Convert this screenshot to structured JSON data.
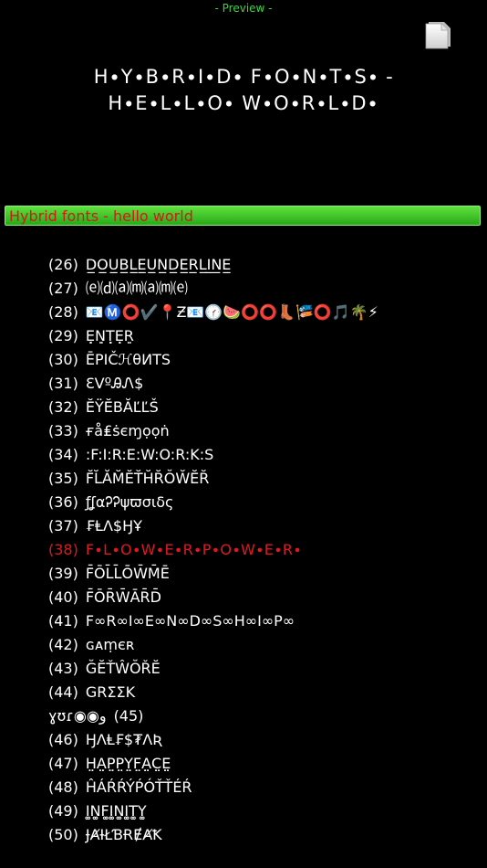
{
  "header": {
    "preview_label": "- Preview -",
    "copy_icon": "copy-document-icon"
  },
  "preview": {
    "line1": "H∙Y∙B∙R∙I∙D∙ F∙O∙N∙T∙S∙ -",
    "line2": "H∙E∙L∙L∙O∙ W∙O∙R∙L∙D∙"
  },
  "selected": {
    "label": "Hybrid fonts - hello world"
  },
  "colors": {
    "selected_bar": "#3cc42a",
    "active_text": "#e0191e",
    "preview_label": "#3fd43f"
  },
  "fonts": [
    {
      "num": "(26)",
      "sample": "D̲O̲U̲B̲L̲E̲U̲N̲D̲E̲R̲L̲I̲N̲E̲"
    },
    {
      "num": "(27)",
      "sample": "⒠⒟⒜⒨⒜⒨⒠"
    },
    {
      "num": "(28)",
      "sample": "📧Ⓜ️⭕✔️📍Ƶ📧🕜🍉⭕⭕👢🎏⭕🎵🌴⚡"
    },
    {
      "num": "(29)",
      "sample": "Ẹ̣Ṇ̣Ṭ̣Ẹ̣Ṛ̣"
    },
    {
      "num": "(30)",
      "sample": "ĒΡΙČℋθИTS"
    },
    {
      "num": "(31)",
      "sample": "ƐVºᎯᏁ$"
    },
    {
      "num": "(32)",
      "sample": "ĔŸĔBĂĽĽŠ"
    },
    {
      "num": "(33)",
      "sample": "ғå₤ṡєɱọọṅ"
    },
    {
      "num": "(34)",
      "sample": ":F:I:R:E:W:O:R:K:S"
    },
    {
      "num": "(35)",
      "sample": "F̆L̆ĂM̆ĔT̆H̆R̆ŎW̆ĔR̆"
    },
    {
      "num": "(36)",
      "sample": "ƒʆαᎮᎮψϖσιδς"
    },
    {
      "num": "(37)",
      "sample": "₣ⱠΛ$ӇҰ"
    },
    {
      "num": "(38)",
      "sample": "F∙L∙O∙W∙E∙R∙P∙O∙W∙E∙R∙",
      "active": true
    },
    {
      "num": "(39)",
      "sample": "F̄ŌL̄L̄ŌW̄M̄Ē"
    },
    {
      "num": "(40)",
      "sample": "F̄ŌR̄W̄ĀR̄D̄"
    },
    {
      "num": "(41)",
      "sample": "F∞R∞I∞E∞N∞D∞S∞H∞I∞P∞"
    },
    {
      "num": "(42)",
      "sample": "ɢᴀṃєʀ"
    },
    {
      "num": "(43)",
      "sample": "ĞĔŤŴŎŘĔ"
    },
    {
      "num": "(44)",
      "sample": "GRΣΣK"
    },
    {
      "num": "(45)",
      "sample": "ɣʊɾ◉◉ﻭ",
      "num_after": true
    },
    {
      "num": "(46)",
      "sample": "ӇΛⱠ₣$₮ΛƦ"
    },
    {
      "num": "(47)",
      "sample": "H̤̤A̤̤P̤̤P̤̤Y̤̤F̤̤A̤̤C̤̤E̤̤"
    },
    {
      "num": "(48)",
      "sample": "ĤÁŔŔÝṔÓŤŤÉŔ"
    },
    {
      "num": "(49)",
      "sample": "I͚N͚F͚I͚N͚I͚T͚Y͚"
    },
    {
      "num": "(50)",
      "sample": "ɈȺƗŁƁɌɆȺꝀ"
    }
  ]
}
